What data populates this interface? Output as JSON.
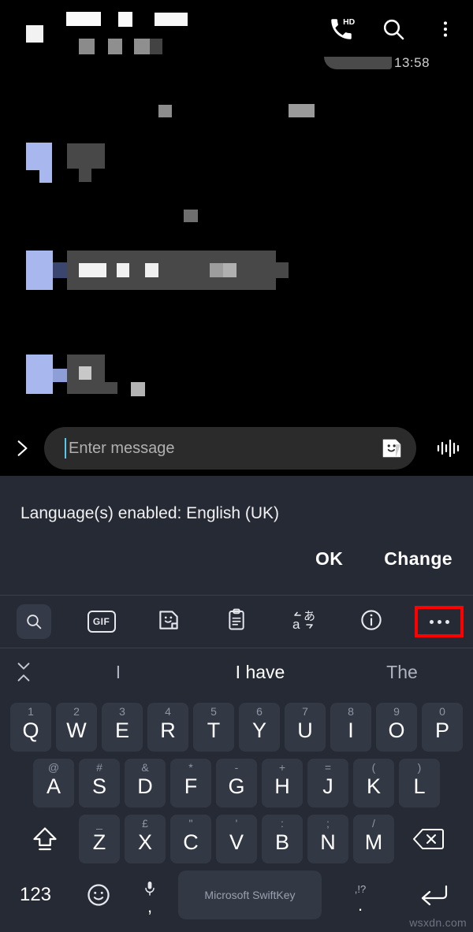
{
  "app": {
    "topbar": {
      "icons": [
        "hd-call-icon",
        "search-icon",
        "overflow-menu-icon"
      ],
      "call_badge": "HD"
    },
    "timestamp_partial": "13:58",
    "input": {
      "expand_icon": "chevron-right-icon",
      "placeholder": "Enter message",
      "value": "",
      "sticker_icon": "sticker-icon",
      "voice_icon": "voice-waveform-icon"
    }
  },
  "keyboard": {
    "notice": {
      "text": "Language(s) enabled: English (UK)",
      "ok_label": "OK",
      "change_label": "Change"
    },
    "toolbar": [
      {
        "name": "search-icon",
        "label": ""
      },
      {
        "name": "gif-icon",
        "label": "GIF"
      },
      {
        "name": "sticker-icon",
        "label": ""
      },
      {
        "name": "clipboard-icon",
        "label": ""
      },
      {
        "name": "translate-icon",
        "label": ""
      },
      {
        "name": "info-icon",
        "label": ""
      },
      {
        "name": "more-options-icon",
        "label": ""
      }
    ],
    "predictions": {
      "toggle_icon": "collapse-expand-icon",
      "items": [
        {
          "text": "I",
          "active": false
        },
        {
          "text": "I have",
          "active": true
        },
        {
          "text": "The",
          "active": false
        }
      ]
    },
    "rows": [
      [
        {
          "main": "Q",
          "sub": "1"
        },
        {
          "main": "W",
          "sub": "2"
        },
        {
          "main": "E",
          "sub": "3"
        },
        {
          "main": "R",
          "sub": "4"
        },
        {
          "main": "T",
          "sub": "5"
        },
        {
          "main": "Y",
          "sub": "6"
        },
        {
          "main": "U",
          "sub": "7"
        },
        {
          "main": "I",
          "sub": "8"
        },
        {
          "main": "O",
          "sub": "9"
        },
        {
          "main": "P",
          "sub": "0"
        }
      ],
      [
        {
          "main": "A",
          "sub": "@"
        },
        {
          "main": "S",
          "sub": "#"
        },
        {
          "main": "D",
          "sub": "&"
        },
        {
          "main": "F",
          "sub": "*"
        },
        {
          "main": "G",
          "sub": "-"
        },
        {
          "main": "H",
          "sub": "+"
        },
        {
          "main": "J",
          "sub": "="
        },
        {
          "main": "K",
          "sub": "("
        },
        {
          "main": "L",
          "sub": ")"
        }
      ],
      [
        {
          "main": "Z",
          "sub": "_"
        },
        {
          "main": "X",
          "sub": "£"
        },
        {
          "main": "C",
          "sub": "\""
        },
        {
          "main": "V",
          "sub": "'"
        },
        {
          "main": "B",
          "sub": ":"
        },
        {
          "main": "N",
          "sub": ";"
        },
        {
          "main": "M",
          "sub": "/"
        }
      ]
    ],
    "shift_key": "shift-icon",
    "backspace_key": "backspace-icon",
    "bottom": {
      "numeric_label": "123",
      "emoji_icon": "emoji-icon",
      "mic_icon": "microphone-icon",
      "comma_label": ",",
      "space_label": "Microsoft SwiftKey",
      "period_sub": ",!?",
      "period_label": ".",
      "enter_icon": "enter-icon"
    }
  },
  "watermark": "wsxdn.com",
  "colors": {
    "chat_bg": "#000000",
    "keyboard_bg": "#262a35",
    "key_bg": "#333845",
    "highlight": "#ff0000",
    "accent_caret": "#5ac8e8",
    "avatar": "#a8b8ef",
    "bubble": "#484848"
  }
}
